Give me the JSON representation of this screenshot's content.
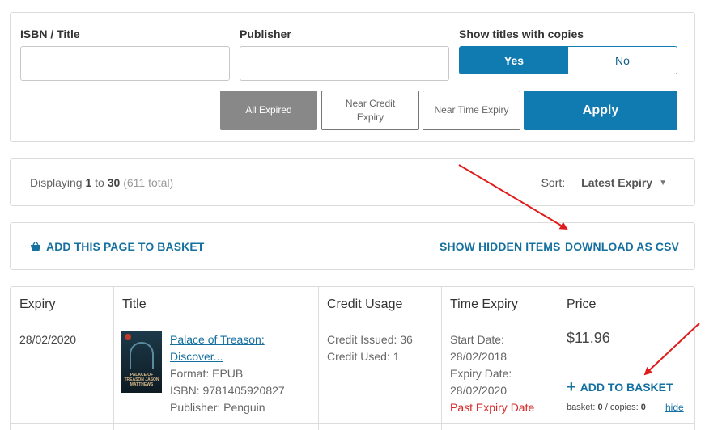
{
  "filters": {
    "isbn_label": "ISBN / Title",
    "isbn_value": "",
    "publisher_label": "Publisher",
    "publisher_value": "",
    "copies_label": "Show titles with copies",
    "copies_yes": "Yes",
    "copies_no": "No",
    "btn_all_expired": "All Expired",
    "btn_near_credit": "Near Credit Expiry",
    "btn_near_time": "Near Time Expiry",
    "apply": "Apply"
  },
  "display": {
    "prefix": "Displaying",
    "from": "1",
    "to_word": "to",
    "to": "30",
    "total": "(611 total)",
    "sort_label": "Sort:",
    "sort_value": "Latest Expiry"
  },
  "actions": {
    "add_page": "ADD THIS PAGE TO BASKET",
    "show_hidden": "SHOW HIDDEN ITEMS",
    "download_csv": "DOWNLOAD AS CSV"
  },
  "table": {
    "headers": [
      "Expiry",
      "Title",
      "Credit Usage",
      "Time Expiry",
      "Price"
    ],
    "rows": [
      {
        "expiry": "28/02/2020",
        "title_line1": "Palace of Treason:",
        "title_line2": "Discover...",
        "format": "Format: EPUB",
        "isbn": "ISBN: 9781405920827",
        "publisher": "Publisher: Penguin",
        "cover_text": "PALACE OF TREASON JASON MATTHEWS",
        "credit_issued": "Credit Issued: 36",
        "credit_used": "Credit Used: 1",
        "start_date_label": "Start Date:",
        "start_date": "28/02/2018",
        "expiry_date_label": "Expiry Date:",
        "expiry_date": "28/02/2020",
        "past_expiry": "Past Expiry Date",
        "price": "$11.96",
        "add_to_basket": "ADD TO BASKET",
        "basket_label": "basket:",
        "basket_count": "0",
        "copies_label": "/ copies:",
        "copies_count": "0",
        "hide": "hide"
      }
    ]
  },
  "colors": {
    "accent": "#0f7bb0",
    "link": "#1570a0",
    "alert": "#d62828",
    "annotation_arrow": "#e01b1b"
  }
}
